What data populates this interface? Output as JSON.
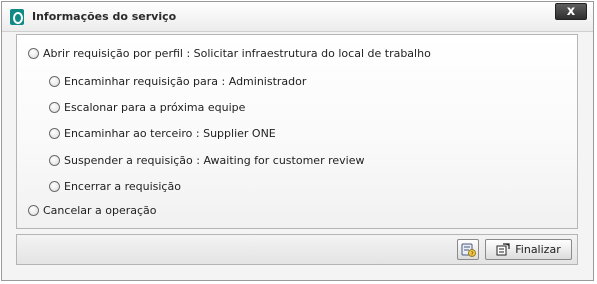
{
  "window": {
    "title": "Informações do serviço",
    "close_label": "x"
  },
  "options": {
    "open_request": "Abrir requisição por perfil : Solicitar infraestrutura do local de trabalho",
    "forward_request": "Encaminhar requisição para : Administrador",
    "escalate": "Escalonar para a próxima equipe",
    "forward_third_party": "Encaminhar ao terceiro : Supplier ONE",
    "suspend_request": "Suspender a requisição : Awaiting for customer review",
    "close_request": "Encerrar a requisição",
    "cancel_operation": "Cancelar a operação"
  },
  "footer": {
    "finish_label": "Finalizar",
    "help_icon": "help-icon",
    "finish_icon": "finish-icon"
  }
}
